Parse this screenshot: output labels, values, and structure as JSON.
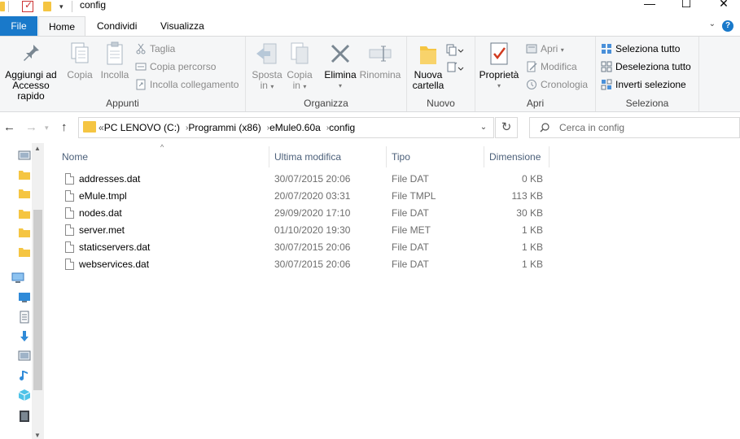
{
  "window": {
    "title": "config",
    "controls": {
      "minimize": "—",
      "maximize": "☐",
      "close": "✕"
    }
  },
  "tabs": [
    {
      "label": "File"
    },
    {
      "label": "Home"
    },
    {
      "label": "Condividi"
    },
    {
      "label": "Visualizza"
    }
  ],
  "ribbon": {
    "groups": {
      "appunti": "Appunti",
      "organizza": "Organizza",
      "nuovo": "Nuovo",
      "apri": "Apri",
      "seleziona": "Seleziona"
    },
    "pin_line1": "Aggiungi ad",
    "pin_line2": "Accesso rapido",
    "copy": "Copia",
    "paste": "Incolla",
    "cut": "Taglia",
    "copy_path": "Copia percorso",
    "paste_link": "Incolla collegamento",
    "move_line1": "Sposta",
    "move_line2": "in",
    "copyto_line1": "Copia",
    "copyto_line2": "in",
    "delete": "Elimina",
    "rename": "Rinomina",
    "newfolder_line1": "Nuova",
    "newfolder_line2": "cartella",
    "properties": "Proprietà",
    "open": "Apri",
    "edit": "Modifica",
    "history": "Cronologia",
    "select_all": "Seleziona tutto",
    "select_none": "Deseleziona tutto",
    "invert_selection": "Inverti selezione"
  },
  "address": {
    "overflow": "«",
    "crumbs": [
      "PC LENOVO (C:)",
      "Programmi (x86)",
      "eMule0.60a",
      "config"
    ]
  },
  "search": {
    "placeholder": "Cerca in config"
  },
  "columns": {
    "name": "Nome",
    "modified": "Ultima modifica",
    "type": "Tipo",
    "size": "Dimensione"
  },
  "files": [
    {
      "name": "addresses.dat",
      "modified": "30/07/2015 20:06",
      "type": "File DAT",
      "size": "0 KB"
    },
    {
      "name": "eMule.tmpl",
      "modified": "20/07/2020 03:31",
      "type": "File TMPL",
      "size": "113 KB"
    },
    {
      "name": "nodes.dat",
      "modified": "29/09/2020 17:10",
      "type": "File DAT",
      "size": "30 KB"
    },
    {
      "name": "server.met",
      "modified": "01/10/2020 19:30",
      "type": "File MET",
      "size": "1 KB"
    },
    {
      "name": "staticservers.dat",
      "modified": "30/07/2015 20:06",
      "type": "File DAT",
      "size": "1 KB"
    },
    {
      "name": "webservices.dat",
      "modified": "30/07/2015 20:06",
      "type": "File DAT",
      "size": "1 KB"
    }
  ],
  "colors": {
    "file_tab": "#1979ca",
    "folder": "#f5c542",
    "header_text": "#4c607a"
  }
}
